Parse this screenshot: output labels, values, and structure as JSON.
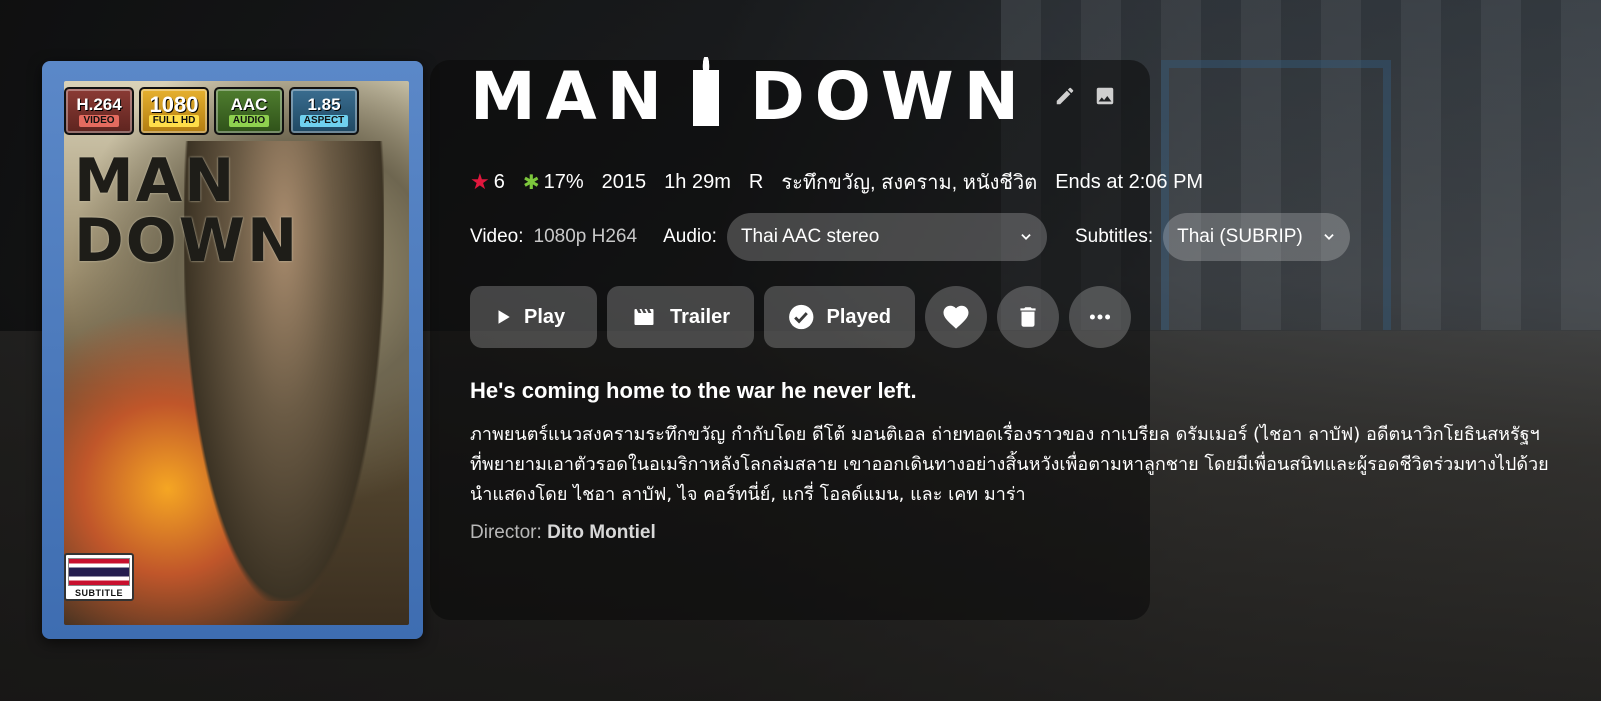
{
  "poster": {
    "title_line1": "MAN",
    "title_line2": "DOWN",
    "badges": [
      {
        "top": "H.264",
        "bottom": "VIDEO"
      },
      {
        "top": "1080",
        "bottom": "FULL HD"
      },
      {
        "top": "AAC",
        "bottom": "AUDIO"
      },
      {
        "top": "1.85",
        "bottom": "ASPECT"
      }
    ],
    "subtitle_badge": "SUBTITLE"
  },
  "title": {
    "left": "MAN",
    "right": "DOWN",
    "edit_icon": "pencil-icon",
    "image_icon": "image-icon"
  },
  "meta": {
    "rating": "6",
    "critic_score": "17%",
    "year": "2015",
    "runtime": "1h 29m",
    "certification": "R",
    "genres": "ระทึกขวัญ, สงคราม, หนังชีวิต",
    "ends_at": "Ends at 2:06 PM",
    "star_color": "#e0173d",
    "critic_color": "#7cc63c"
  },
  "streams": {
    "video_label": "Video:",
    "video_value": "1080p H264",
    "audio_label": "Audio:",
    "audio_value": "Thai AAC stereo",
    "subtitles_label": "Subtitles:",
    "subtitles_value": "Thai (SUBRIP)"
  },
  "actions": {
    "play": "Play",
    "trailer": "Trailer",
    "played": "Played",
    "favorite_icon": "heart-icon",
    "delete_icon": "trash-icon",
    "more_icon": "more-icon"
  },
  "tagline": "He's coming home to the war he never left.",
  "overview": "ภาพยนตร์แนวสงครามระทึกขวัญ กำกับโดย ดีโต้ มอนติเอล ถ่ายทอดเรื่องราวของ กาเบรียล ดรัมเมอร์ (ไชอา ลาบัฟ) อดีตนาวิกโยธินสหรัฐฯ ที่พยายามเอาตัวรอดในอเมริกาหลังโลกล่มสลาย เขาออกเดินทางอย่างสิ้นหวังเพื่อตามหาลูกชาย โดยมีเพื่อนสนิทและผู้รอดชีวิตร่วมทางไปด้วย นำแสดงโดย ไชอา ลาบัฟ, ไจ คอร์ทนี่ย์, แกรี่ โอลด์แมน, และ เคท มาร่า",
  "director": {
    "label": "Director:",
    "name": "Dito Montiel"
  }
}
